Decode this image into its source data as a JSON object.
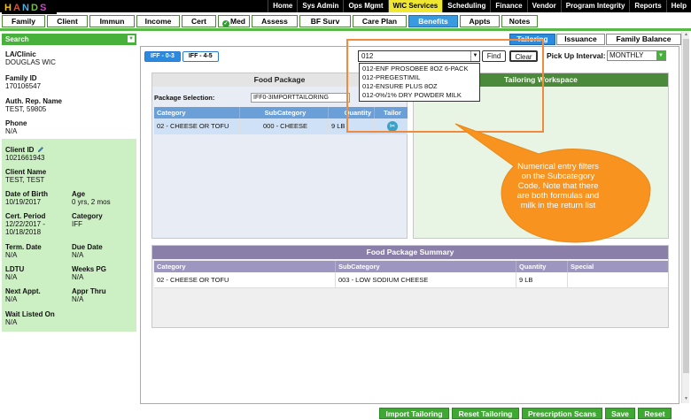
{
  "top_menu": [
    "Home",
    "Sys Admin",
    "Ops Mgmt",
    "WIC Services",
    "Scheduling",
    "Finance",
    "Vendor",
    "Program Integrity",
    "Reports",
    "Help"
  ],
  "active_top": "WIC Services",
  "tabs": [
    "Family",
    "Client",
    "Immun",
    "Income",
    "Cert",
    "Med",
    "Assess",
    "BF Surv",
    "Care Plan",
    "Benefits",
    "Appts",
    "Notes"
  ],
  "active_tab": "Benefits",
  "sidebar": {
    "search_label": "Search",
    "clinic_label": "LA/Clinic",
    "clinic_value": "DOUGLAS WIC",
    "family_id_label": "Family ID",
    "family_id_value": "170106547",
    "auth_rep_label": "Auth. Rep. Name",
    "auth_rep_value": "TEST, 59805",
    "phone_label": "Phone",
    "phone_value": "N/A",
    "client_id_label": "Client ID",
    "client_id_value": "1021661943",
    "client_name_label": "Client Name",
    "client_name_value": "TEST, TEST",
    "dob_label": "Date of Birth",
    "dob_value": "10/19/2017",
    "age_label": "Age",
    "age_value": "0 yrs, 2 mos",
    "cert_period_label": "Cert. Period",
    "cert_period_value1": "12/22/2017 -",
    "cert_period_value2": "10/18/2018",
    "category_label": "Category",
    "category_value": "IFF",
    "term_date_label": "Term. Date",
    "term_date_value": "N/A",
    "due_date_label": "Due Date",
    "due_date_value": "N/A",
    "ldtu_label": "LDTU",
    "ldtu_value": "N/A",
    "weeks_pg_label": "Weeks PG",
    "weeks_pg_value": "N/A",
    "next_appt_label": "Next Appt.",
    "next_appt_value": "N/A",
    "appr_thru_label": "Appr Thru",
    "appr_thru_value": "N/A",
    "wait_listed_label": "Wait Listed On",
    "wait_listed_value": "N/A"
  },
  "subtabs": [
    "IFF - 0-3",
    "IFF - 4-5"
  ],
  "right_tabs": [
    "Tailoring",
    "Issuance",
    "Family Balance"
  ],
  "pickup_label": "Pick Up Interval:",
  "pickup_value": "MONTHLY",
  "search_value": "012",
  "find_label": "Find",
  "clear_label": "Clear",
  "dropdown_items": [
    "012-ENF PROSOBEE 8OZ 6-PACK",
    "012-PREGESTIMIL",
    "012-ENSURE PLUS 8OZ",
    "012-0%/1% DRY POWDER MILK"
  ],
  "food_package": {
    "title": "Food Package",
    "selection_label": "Package Selection:",
    "selection_value": "IFF0-3IMPORTTAILORING",
    "columns": [
      "Category",
      "SubCategory",
      "Quantity",
      "Tailor"
    ],
    "row": [
      "02 - CHEESE OR TOFU",
      "000 - CHEESE",
      "9 LB"
    ]
  },
  "tailoring_workspace_title": "Tailoring Workspace",
  "summary": {
    "title": "Food Package Summary",
    "columns": [
      "Category",
      "SubCategory",
      "Quantity",
      "Special"
    ],
    "row": [
      "02 - CHEESE OR TOFU",
      "003 - LOW SODIUM CHEESE",
      "9 LB",
      ""
    ]
  },
  "callout": "Numerical entry filters on the Subcategory Code. Note that there are both formulas and milk in the return list",
  "bottom_buttons": [
    "Import Tailoring",
    "Reset Tailoring",
    "Prescription Scans",
    "Save",
    "Reset"
  ],
  "colors": {
    "green": "#47b13b",
    "blue": "#2a8ae0",
    "orange": "#f7931e",
    "purple": "#8a7fa8"
  }
}
